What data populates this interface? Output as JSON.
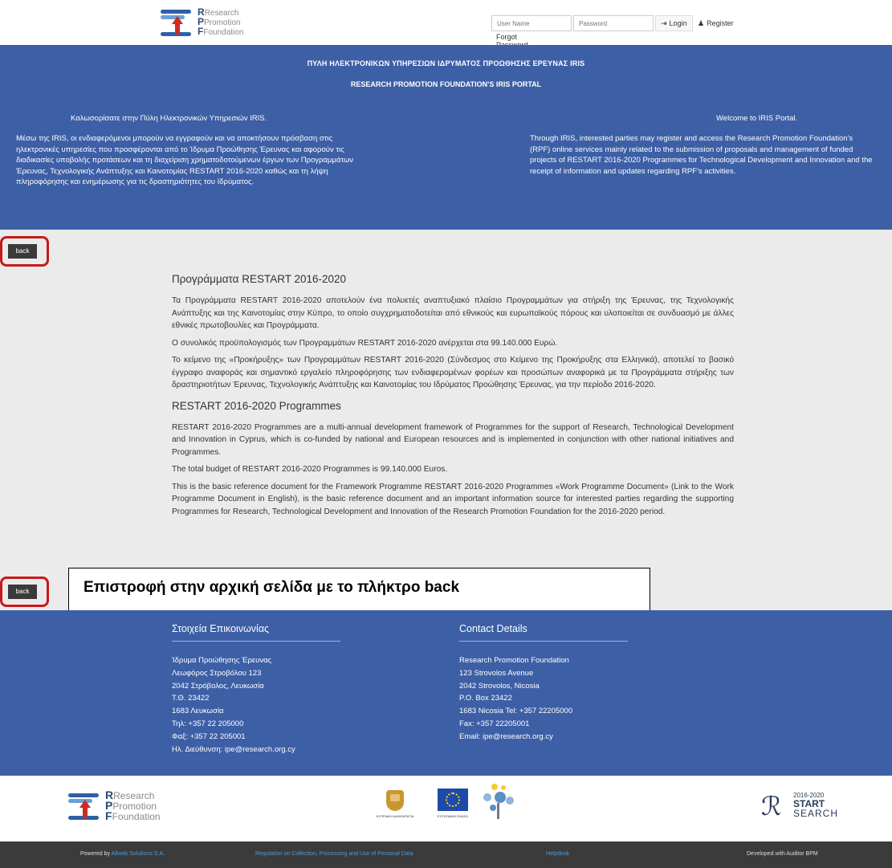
{
  "header": {
    "logo": {
      "line1": "Research",
      "line2": "Promotion",
      "line3": "Foundation"
    },
    "username_placeholder": "User Name",
    "password_placeholder": "Password",
    "login_label": "Login",
    "register_label": "Register",
    "forgot_label": "Forgot Password ?"
  },
  "banner": {
    "title_el": "ΠΥΛΗ ΗΛΕΚΤΡΟΝΙΚΩΝ ΥΠΗΡΕΣΙΩΝ ΙΔΡΥΜΑΤΟΣ ΠΡΟΩΘΗΣΗΣ ΕΡΕΥΝΑΣ IRIS",
    "title_en": "RESEARCH PROMOTION FOUNDATION'S IRIS PORTAL",
    "welcome_el": "Καλωσορίσατε στην Πύλη Ηλεκτρονικών Υπηρεσιών IRIS.",
    "welcome_en": "Welcome to IRIS Portal.",
    "text_el": "Μέσω της IRIS, οι ενδιαφερόμενοι μπορούν να εγγραφούν και να αποκτήσουν πρόσβαση στις ηλεκτρονικές υπηρεσίες που προσφέρονται από το Ίδρυμα Προώθησης Έρευνας και αφορούν τις διαδικασίες υποβολής προτάσεων και τη διαχείριση χρηματοδοτούμενων έργων των Προγραμμάτων Έρευνας, Τεχνολογικής Ανάπτυξης και Καινοτομίας RESTART 2016-2020 καθώς και τη λήψη πληροφόρησης και ενημέρωσης για τις δραστηριότητες του Ιδρύματος.",
    "text_en": "Through IRIS, interested parties may register and access the Research Promotion Foundation's (RPF) online services mainly related to the submission of proposals and management of funded projects of RESTART 2016-2020 Programmes for Technological Development and Innovation and the receipt of information and updates regarding RPF's activities."
  },
  "main": {
    "back_label": "back",
    "heading_el": "Προγράμματα RESTART 2016-2020",
    "p1_el": "Τα Προγράμματα RESTART 2016-2020 αποτελούν ένα πολυετές αναπτυξιακό πλαίσιο Προγραμμάτων για στήριξη της Έρευνας, της Τεχνολογικής Ανάπτυξης και της Καινοτομίας στην Κύπρο, το οποίο συγχρηματοδοτείται από εθνικούς και ευρωπαϊκούς πόρους και υλοποιείται σε συνδυασμό με άλλες εθνικές πρωτοβουλίες και Προγράμματα.",
    "p2_el": "Ο συνολικός προϋπολογισμός των Προγραμμάτων RESTART 2016-2020 ανέρχεται στα 99.140.000 Ευρώ.",
    "p3_el": "Το κείμενο της «Προκήρυξης» των Προγραμμάτων RESTART 2016-2020 (Σύνδεσμος στο Κείμενο της Προκήρυξης στα Ελληνικά), αποτελεί το βασικό έγγραφο αναφοράς και σημαντικό εργαλείο πληροφόρησης των ενδιαφερομένων φορέων και προσώπων αναφορικά με τα Προγράμματα στήριξης των δραστηριοτήτων Έρευνας, Τεχνολογικής Ανάπτυξης και Καινοτομίας του Ιδρύματος Προώθησης Έρευνας, για την περίοδο 2016-2020.",
    "heading_en": "RESTART 2016-2020 Programmes",
    "p1_en": "RESTART 2016-2020 Programmes are a multi-annual development framework of Programmes for the support of Research, Technological Development and Innovation in Cyprus, which is co-funded by national and European resources and is implemented in conjunction with other national initiatives and Programmes.",
    "p2_en": "The total budget of RESTART 2016-2020 Programmes is 99.140.000 Euros.",
    "p3_en": "This is the basic reference document for the Framework Programme RESTART 2016-2020 Programmes «Work Programme Document» (Link to the Work Programme Document in English), is the basic reference document and an important information source for interested parties regarding the supporting Programmes for Research, Technological Development and Innovation of the Research Promotion Foundation for the 2016-2020 period."
  },
  "annotation": "Επιστροφή στην αρχική σελίδα με το πλήκτρο back",
  "footer": {
    "el_title": "Στοιχεία Επικοινωνίας",
    "el_lines": [
      "Ίδρυμα Προώθησης Έρευνας",
      "Λεωφόρος Στροβόλου 123",
      "2042 Στρόβολος, Λευκωσία",
      "Τ.Θ. 23422",
      "1683 Λευκωσία",
      "Τηλ: +357 22 205000",
      "Φαξ: +357 22 205001",
      "Ηλ. Διεύθυνση: ipe@research.org.cy"
    ],
    "en_title": "Contact Details",
    "en_lines": [
      "Research Promotion Foundation",
      "123 Strovolos Avenue",
      "2042 Strovolos, Nicosia",
      "P.O. Box 23422",
      "1683 Nicosia Tel: +357 22205000",
      "Fax: +357 22205001",
      "Email: ipe@research.org.cy"
    ]
  },
  "logos": {
    "cyprus_caption": "ΚΥΠΡΙΑΚΗ ΔΗΜΟΚΡΑΤΙΑ",
    "eu_caption": "ΕΥΡΩΠΑΪΚΗ ΕΝΩΣΗ",
    "restart_years": "2016-2020",
    "restart_start": "START",
    "restart_search": "SEARCH"
  },
  "bottom": {
    "powered_prefix": "Powered by",
    "powered_link": "Allweb Solutions S.A.",
    "regulation": "Regulation on Collection, Processing and Use of Personal Data",
    "helpdesk": "Helpdesk",
    "developed": "Developed with Auditor BPM"
  },
  "colors": {
    "banner_blue": "#3d5fa6",
    "highlight_red": "#c61a1a"
  }
}
